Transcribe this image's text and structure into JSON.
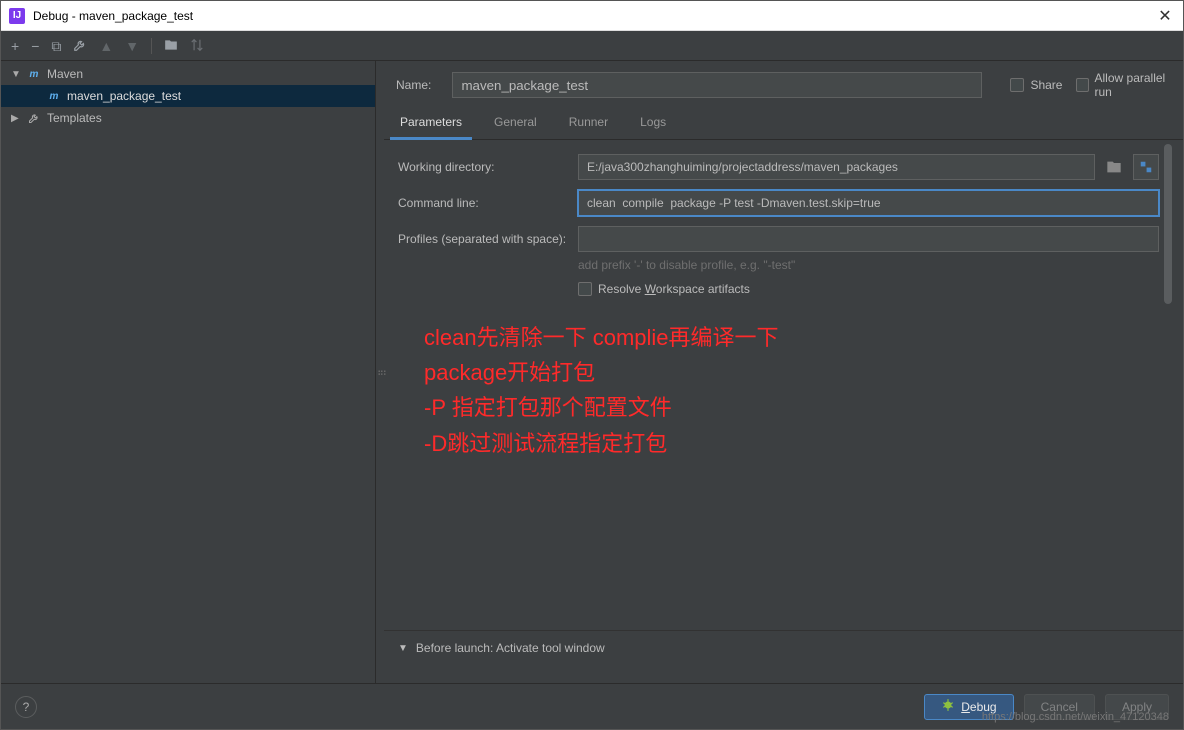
{
  "window": {
    "title": "Debug - maven_package_test"
  },
  "toolbar": {
    "add": "+",
    "remove": "−",
    "copy": "⧉",
    "wrench": "🔧",
    "up": "▲",
    "down": "▼",
    "folder": "📁",
    "sort": "⇅"
  },
  "sidebar": {
    "maven_label": "Maven",
    "maven_item": "maven_package_test",
    "templates_label": "Templates"
  },
  "header": {
    "name_label": "Name:",
    "name_value": "maven_package_test",
    "share_label": "Share",
    "parallel_label": "Allow parallel run"
  },
  "tabs": {
    "parameters": "Parameters",
    "general": "General",
    "runner": "Runner",
    "logs": "Logs"
  },
  "form": {
    "workdir_label": "Working directory:",
    "workdir_value": "E:/java300zhanghuiming/projectaddress/maven_packages",
    "cmd_label": "Command line:",
    "cmd_value": "clean  compile  package -P test -Dmaven.test.skip=true",
    "profiles_label": "Profiles (separated with space):",
    "profiles_hint": "add prefix '-' to disable profile, e.g. \"-test\"",
    "resolve_label_pre": "Resolve ",
    "resolve_label_mn": "W",
    "resolve_label_post": "orkspace artifacts"
  },
  "annotation": "clean先清除一下 complie再编译一下\npackage开始打包\n-P 指定打包那个配置文件\n-D跳过测试流程指定打包",
  "before_launch": {
    "header": "Before launch: Activate tool window"
  },
  "footer": {
    "debug_mn": "D",
    "debug_post": "ebug",
    "cancel": "Cancel",
    "apply": "Apply"
  },
  "watermark": "https://blog.csdn.net/weixin_47120348"
}
